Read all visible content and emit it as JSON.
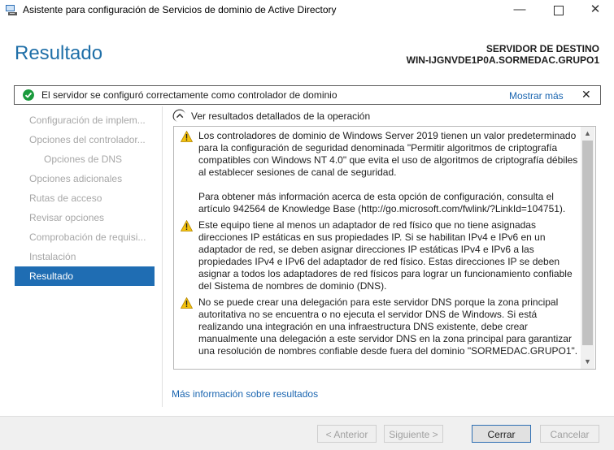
{
  "window": {
    "title": "Asistente para configuración de Servicios de dominio de Active Directory",
    "minimize": "—",
    "close": "✕"
  },
  "header": {
    "page_title": "Resultado",
    "server_label": "SERVIDOR DE DESTINO",
    "server_name": "WIN-IJGNVDE1P0A.SORMEDAC.GRUPO1"
  },
  "notification": {
    "text": "El servidor se configuró correctamente como controlador de dominio",
    "more_link": "Mostrar más",
    "close": "✕"
  },
  "sidebar": {
    "items": [
      {
        "label": "Configuración de implem..."
      },
      {
        "label": "Opciones del controlador..."
      },
      {
        "label": "Opciones de DNS"
      },
      {
        "label": "Opciones adicionales"
      },
      {
        "label": "Rutas de acceso"
      },
      {
        "label": "Revisar opciones"
      },
      {
        "label": "Comprobación de requisi..."
      },
      {
        "label": "Instalación"
      },
      {
        "label": "Resultado"
      }
    ]
  },
  "results": {
    "expander_label": "Ver resultados detallados de la operación",
    "messages": [
      {
        "p1": "Los controladores de dominio de Windows Server 2019 tienen un valor predeterminado para la configuración de seguridad denominada \"Permitir algoritmos de criptografía compatibles con Windows NT 4.0\" que evita el uso de algoritmos de criptografía débiles al establecer sesiones de canal de seguridad.",
        "p2": "Para obtener más información acerca de esta opción de configuración, consulta el artículo 942564 de Knowledge Base (http://go.microsoft.com/fwlink/?LinkId=104751)."
      },
      {
        "p1": "Este equipo tiene al menos un adaptador de red físico que no tiene asignadas direcciones IP estáticas en sus propiedades IP. Si se habilitan IPv4 e IPv6 en un adaptador de red, se deben asignar direcciones IP estáticas IPv4 e IPv6 a las propiedades IPv4 e IPv6 del adaptador de red físico. Estas direcciones IP se deben asignar a todos los adaptadores de red físicos para lograr un funcionamiento confiable del Sistema de nombres de dominio (DNS)."
      },
      {
        "p1": "No se puede crear una delegación para este servidor DNS porque la zona principal autoritativa no se encuentra o no ejecuta el servidor DNS de Windows. Si está realizando una integración en una infraestructura DNS existente, debe crear manualmente una delegación a este servidor DNS en la zona principal para garantizar una resolución de nombres confiable desde fuera del dominio \"SORMEDAC.GRUPO1\"."
      }
    ],
    "more_info_link": "Más información sobre resultados"
  },
  "footer": {
    "prev": "< Anterior",
    "next": "Siguiente >",
    "close": "Cerrar",
    "cancel": "Cancelar"
  }
}
